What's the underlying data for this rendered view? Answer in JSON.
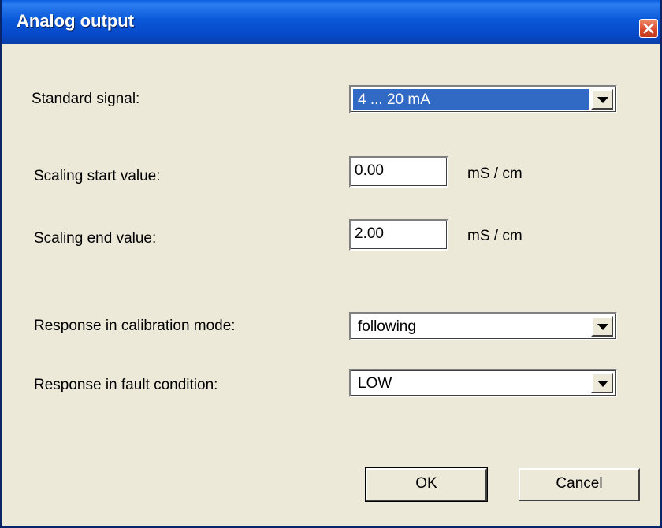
{
  "window": {
    "title": "Analog output"
  },
  "fields": {
    "standard_signal": {
      "label": "Standard signal:",
      "value": "4 ... 20 mA"
    },
    "scaling_start": {
      "label": "Scaling start value:",
      "value": "0.00",
      "unit": "mS / cm"
    },
    "scaling_end": {
      "label": "Scaling end value:",
      "value": "2.00",
      "unit": "mS / cm"
    },
    "response_calibration": {
      "label": "Response in calibration mode:",
      "value": "following"
    },
    "response_fault": {
      "label": "Response in fault condition:",
      "value": "LOW"
    }
  },
  "buttons": {
    "ok": "OK",
    "cancel": "Cancel"
  },
  "colors": {
    "titlebar": "#0A58D8",
    "selection": "#316AC5",
    "dialog_bg": "#ECE9D8",
    "close_button": "#D9462A"
  },
  "icons": {
    "close": "close-icon",
    "dropdown": "chevron-down-icon"
  }
}
